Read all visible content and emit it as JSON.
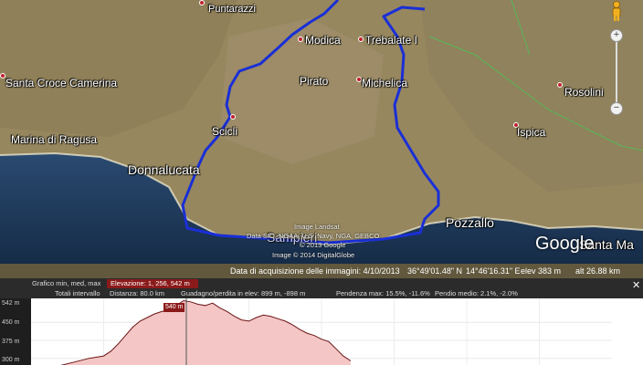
{
  "map": {
    "places": {
      "puntarazzi": "Puntarazzi",
      "modica": "Modica",
      "trebalate": "Trebalate I",
      "santa_croce": "Santa Croce Camerina",
      "pirato": "Pirato",
      "michelica": "Michelica",
      "rosolini": "Rosolini",
      "marina_di_ragusa": "Marina di Ragusa",
      "scicli": "Scicli",
      "ispica": "Ispica",
      "donnalucata": "Donnalucata",
      "pozzallo": "Pozzallo",
      "santa_maria": "Santa Ma"
    },
    "credits": {
      "landsat": "Image Landsat",
      "data": "Data SIO, NOAA, U.S. Navy, NGA, GEBCO",
      "google_copy": "© 2013 Google",
      "digitalglobe": "Image © 2014 DigitalGlobe"
    },
    "overlay_label": "Sampieri",
    "google_logo": "Google",
    "status": {
      "date_label": "Data di acquisizione delle immagini: 4/10/2013",
      "lat": "36°49'01.48\" N",
      "lon": "14°46'16.31\" E",
      "elev": "elev   383 m",
      "alt": "alt  26.88 km"
    },
    "nav": {
      "zoom_in": "+",
      "zoom_out": "−"
    },
    "colors": {
      "track": "#1a2fd6",
      "sea": "#1e3a5c",
      "land": "#9a8a66"
    }
  },
  "elevation": {
    "header": {
      "graph_label": "Grafico  min, med, max",
      "elev_label": "Elevazione:  1, 256, 542 m",
      "totals_label": "Totali intervallo",
      "distance": "Distanza:  80.0 km",
      "gain_loss": "Guadagno/perdita in elev:  899 m, -898 m",
      "max_grade": "Pendenza max:  15.5%, -11.6%",
      "avg_grade": "Pendio medio:  2.1%, -2.0%",
      "close": "✕"
    },
    "y_ticks": [
      "542 m",
      "450 m",
      "375 m",
      "300 m"
    ],
    "marker_label": "540 m",
    "colors": {
      "fill": "#f4c6c6",
      "line": "#6b1515",
      "marker": "#8b1a1a"
    }
  },
  "chart_data": {
    "type": "area",
    "ylabel": "",
    "ylim": [
      280,
      542
    ],
    "x": [
      0,
      2,
      4,
      6,
      8,
      10,
      11,
      12,
      13,
      14,
      15,
      16,
      17,
      18,
      19,
      20,
      21,
      22,
      23,
      24,
      25,
      26,
      27,
      28,
      29,
      30,
      31,
      32,
      33,
      34,
      35,
      36,
      37,
      38,
      39,
      40,
      41,
      42,
      43,
      44
    ],
    "series": [
      {
        "values": [
          230,
          250,
          270,
          285,
          300,
          310,
          330,
          360,
          395,
          430,
          455,
          470,
          485,
          495,
          500,
          520,
          540,
          535,
          525,
          520,
          530,
          510,
          495,
          475,
          460,
          455,
          470,
          480,
          475,
          465,
          455,
          440,
          420,
          405,
          395,
          380,
          370,
          340,
          310,
          290
        ]
      }
    ]
  }
}
